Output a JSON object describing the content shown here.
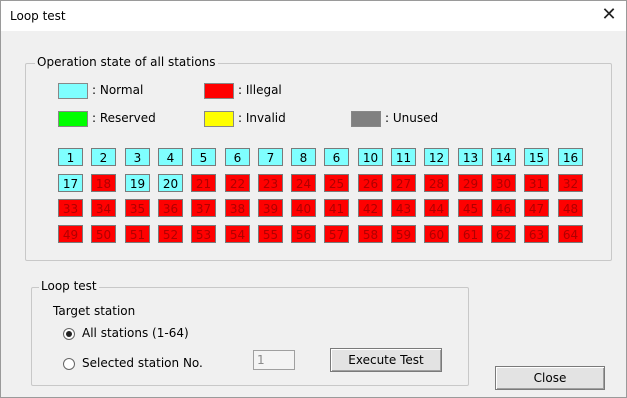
{
  "window": {
    "title": "Loop test"
  },
  "operation_state": {
    "group_label": "Operation state of all stations",
    "legend": [
      {
        "key": "normal",
        "label": ": Normal",
        "color": "#7fffff"
      },
      {
        "key": "illegal",
        "label": ": Illegal",
        "color": "#ff0000"
      },
      {
        "key": "reserved",
        "label": ": Reserved",
        "color": "#00ff00"
      },
      {
        "key": "invalid",
        "label": ": Invalid",
        "color": "#ffff00"
      },
      {
        "key": "unused",
        "label": ": Unused",
        "color": "#808080"
      }
    ],
    "stations": [
      {
        "n": "1",
        "s": "normal"
      },
      {
        "n": "2",
        "s": "normal"
      },
      {
        "n": "3",
        "s": "normal"
      },
      {
        "n": "4",
        "s": "normal"
      },
      {
        "n": "5",
        "s": "normal"
      },
      {
        "n": "6",
        "s": "normal"
      },
      {
        "n": "7",
        "s": "normal"
      },
      {
        "n": "8",
        "s": "normal"
      },
      {
        "n": "6",
        "s": "normal"
      },
      {
        "n": "10",
        "s": "normal"
      },
      {
        "n": "11",
        "s": "normal"
      },
      {
        "n": "12",
        "s": "normal"
      },
      {
        "n": "13",
        "s": "normal"
      },
      {
        "n": "14",
        "s": "normal"
      },
      {
        "n": "15",
        "s": "normal"
      },
      {
        "n": "16",
        "s": "normal"
      },
      {
        "n": "17",
        "s": "normal"
      },
      {
        "n": "18",
        "s": "illegal"
      },
      {
        "n": "19",
        "s": "normal"
      },
      {
        "n": "20",
        "s": "normal"
      },
      {
        "n": "21",
        "s": "illegal"
      },
      {
        "n": "22",
        "s": "illegal"
      },
      {
        "n": "23",
        "s": "illegal"
      },
      {
        "n": "24",
        "s": "illegal"
      },
      {
        "n": "25",
        "s": "illegal"
      },
      {
        "n": "26",
        "s": "illegal"
      },
      {
        "n": "27",
        "s": "illegal"
      },
      {
        "n": "28",
        "s": "illegal"
      },
      {
        "n": "29",
        "s": "illegal"
      },
      {
        "n": "30",
        "s": "illegal"
      },
      {
        "n": "31",
        "s": "illegal"
      },
      {
        "n": "32",
        "s": "illegal"
      },
      {
        "n": "33",
        "s": "illegal"
      },
      {
        "n": "34",
        "s": "illegal"
      },
      {
        "n": "35",
        "s": "illegal"
      },
      {
        "n": "36",
        "s": "illegal"
      },
      {
        "n": "37",
        "s": "illegal"
      },
      {
        "n": "38",
        "s": "illegal"
      },
      {
        "n": "39",
        "s": "illegal"
      },
      {
        "n": "40",
        "s": "illegal"
      },
      {
        "n": "41",
        "s": "illegal"
      },
      {
        "n": "42",
        "s": "illegal"
      },
      {
        "n": "43",
        "s": "illegal"
      },
      {
        "n": "44",
        "s": "illegal"
      },
      {
        "n": "45",
        "s": "illegal"
      },
      {
        "n": "46",
        "s": "illegal"
      },
      {
        "n": "47",
        "s": "illegal"
      },
      {
        "n": "48",
        "s": "illegal"
      },
      {
        "n": "49",
        "s": "illegal"
      },
      {
        "n": "50",
        "s": "illegal"
      },
      {
        "n": "51",
        "s": "illegal"
      },
      {
        "n": "52",
        "s": "illegal"
      },
      {
        "n": "53",
        "s": "illegal"
      },
      {
        "n": "54",
        "s": "illegal"
      },
      {
        "n": "55",
        "s": "illegal"
      },
      {
        "n": "56",
        "s": "illegal"
      },
      {
        "n": "57",
        "s": "illegal"
      },
      {
        "n": "58",
        "s": "illegal"
      },
      {
        "n": "59",
        "s": "illegal"
      },
      {
        "n": "60",
        "s": "illegal"
      },
      {
        "n": "61",
        "s": "illegal"
      },
      {
        "n": "62",
        "s": "illegal"
      },
      {
        "n": "63",
        "s": "illegal"
      },
      {
        "n": "64",
        "s": "illegal"
      }
    ]
  },
  "loop_test": {
    "group_label": "Loop test",
    "target_label": "Target station",
    "option_all": "All stations (1-64)",
    "option_selected": "Selected station No.",
    "selected_option": "all",
    "station_no_value": "1",
    "execute_label": "Execute Test"
  },
  "close_label": "Close"
}
